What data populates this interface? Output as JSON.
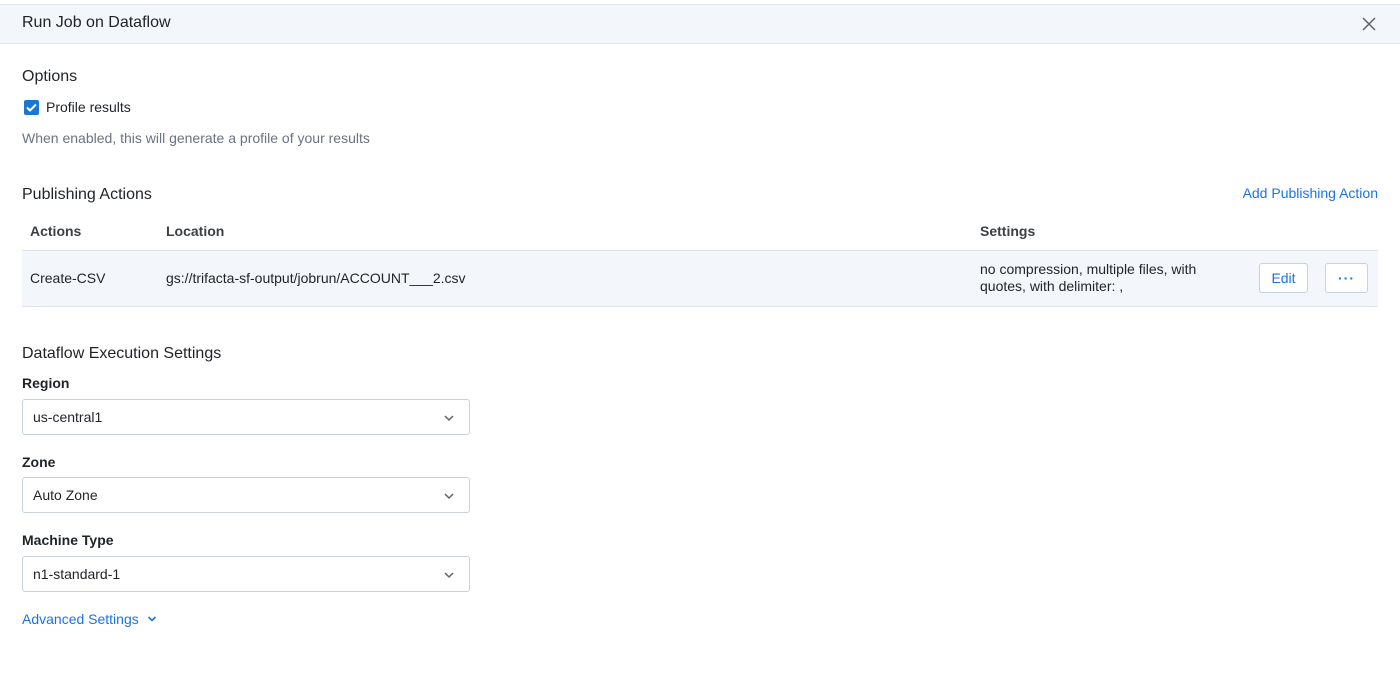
{
  "dialog": {
    "title": "Run Job on Dataflow"
  },
  "options": {
    "title": "Options",
    "profile_label": "Profile results",
    "profile_checked": true,
    "hint": "When enabled, this will generate a profile of your results"
  },
  "publishing": {
    "title": "Publishing Actions",
    "add_action": "Add Publishing Action",
    "columns": {
      "actions": "Actions",
      "location": "Location",
      "settings": "Settings"
    },
    "rows": [
      {
        "action": "Create-CSV",
        "location": "gs://trifacta-sf-output/jobrun/ACCOUNT___2.csv",
        "settings_line1": "no compression, multiple files, with",
        "settings_line2": "quotes, with delimiter: ,",
        "edit_label": "Edit",
        "more_label": "···"
      }
    ]
  },
  "execution": {
    "title": "Dataflow Execution Settings",
    "region_label": "Region",
    "region_value": "us-central1",
    "zone_label": "Zone",
    "zone_value": "Auto Zone",
    "machine_label": "Machine Type",
    "machine_value": "n1-standard-1",
    "advanced_label": "Advanced Settings"
  },
  "colors": {
    "accent": "#1a73e8",
    "checkbox": "#1976d2",
    "header_bg": "#f3f6fa",
    "row_bg": "#f3f6fa"
  },
  "icons": {
    "close": "close-icon",
    "check": "checkmark-icon",
    "chevron": "chevron-down-icon"
  }
}
